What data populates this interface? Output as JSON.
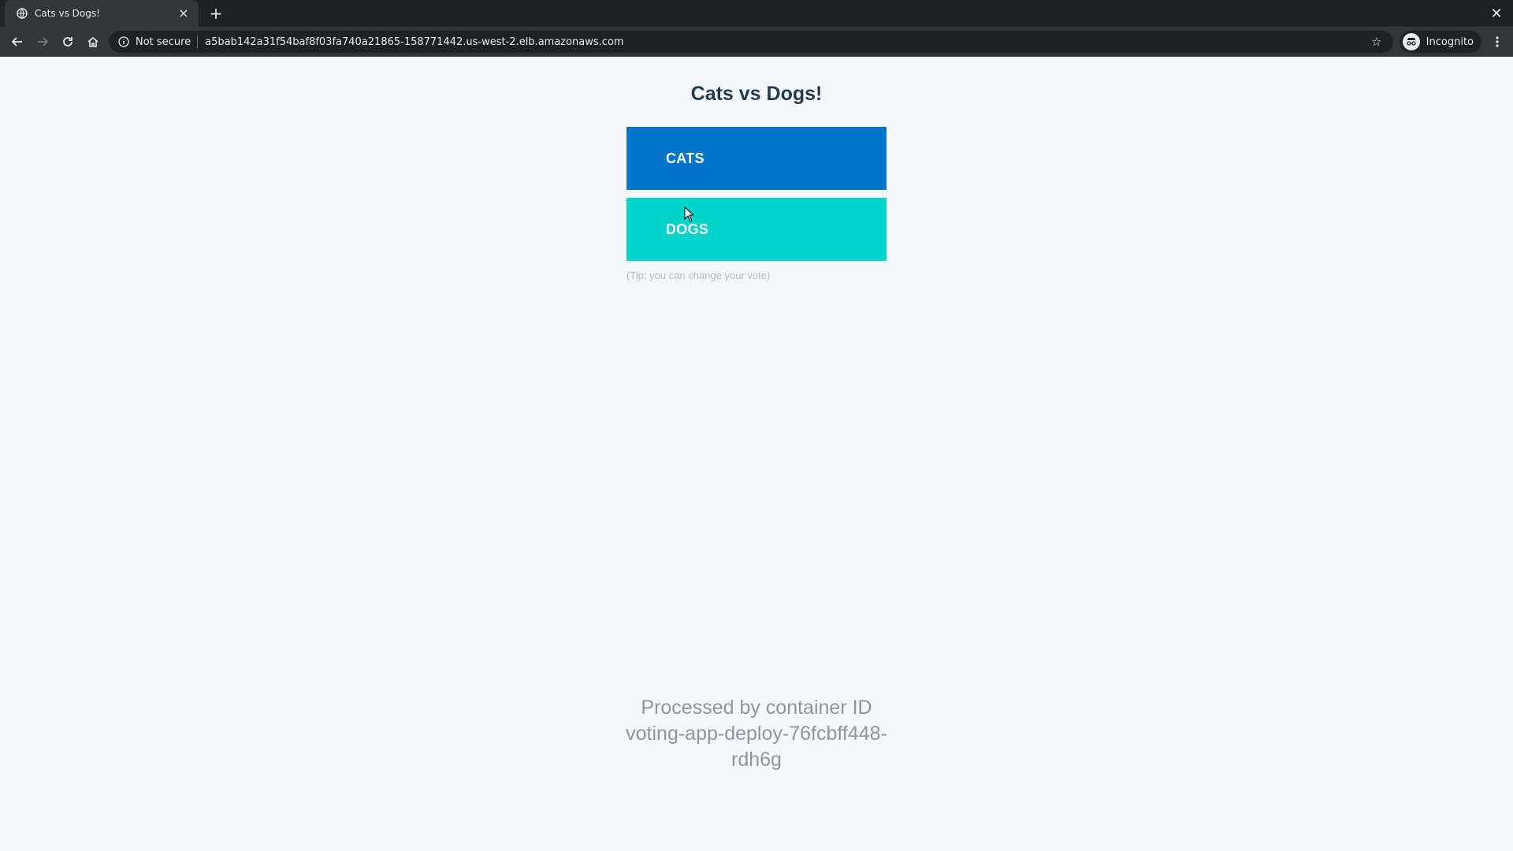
{
  "browser": {
    "tab": {
      "title": "Cats vs Dogs!"
    },
    "omnibox": {
      "security_label": "Not secure",
      "url": "a5bab142a31f54baf8f03fa740a21865-158771442.us-west-2.elb.amazonaws.com"
    },
    "profile": {
      "label": "Incognito"
    }
  },
  "page": {
    "title": "Cats vs Dogs!",
    "cats_label": "CATS",
    "dogs_label": "DOGS",
    "tip": "(Tip: you can change your vote)",
    "footer": {
      "line1": "Processed by container ID",
      "line2": "voting-app-deploy-76fcbff448-",
      "line3": "rdh6g"
    }
  },
  "colors": {
    "cats": "#0275c9",
    "dogs": "#00d4cb",
    "title": "#1f3b50"
  }
}
